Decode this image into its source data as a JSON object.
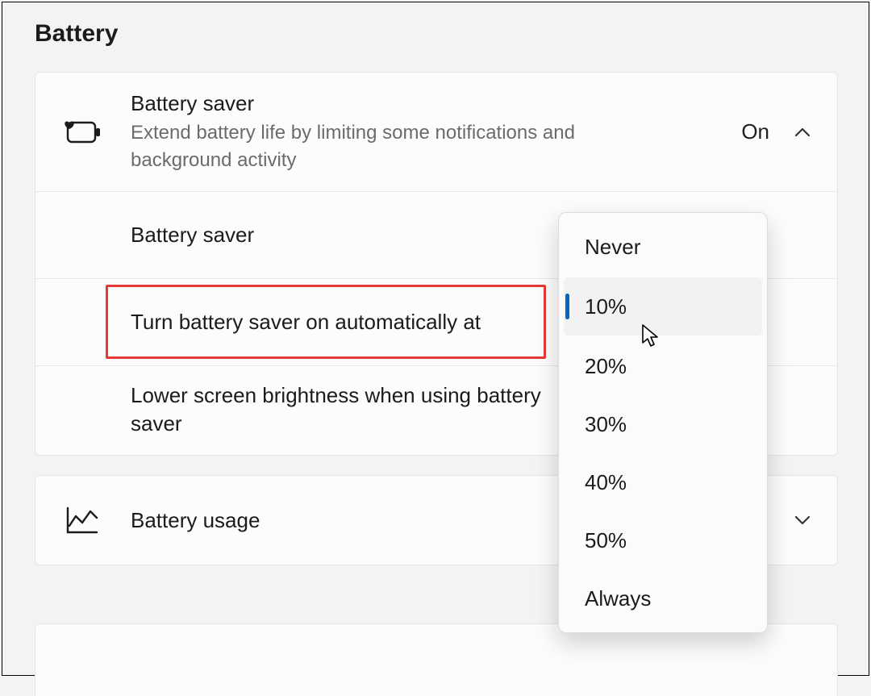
{
  "section_title": "Battery",
  "saver": {
    "title": "Battery saver",
    "subtitle": "Extend battery life by limiting some notifications and background activity",
    "state": "On",
    "rows": {
      "mode_label": "Battery saver",
      "auto_label": "Turn battery saver on automatically at",
      "brightness_label": "Lower screen brightness when using battery saver"
    },
    "threshold_options": [
      "Never",
      "10%",
      "20%",
      "30%",
      "40%",
      "50%",
      "Always"
    ],
    "threshold_selected": "10%"
  },
  "usage": {
    "title": "Battery usage"
  },
  "icons": {
    "battery_saver": "battery-saver-icon",
    "chart": "chart-icon",
    "chevron_up": "chevron-up-icon",
    "chevron_down": "chevron-down-icon"
  }
}
